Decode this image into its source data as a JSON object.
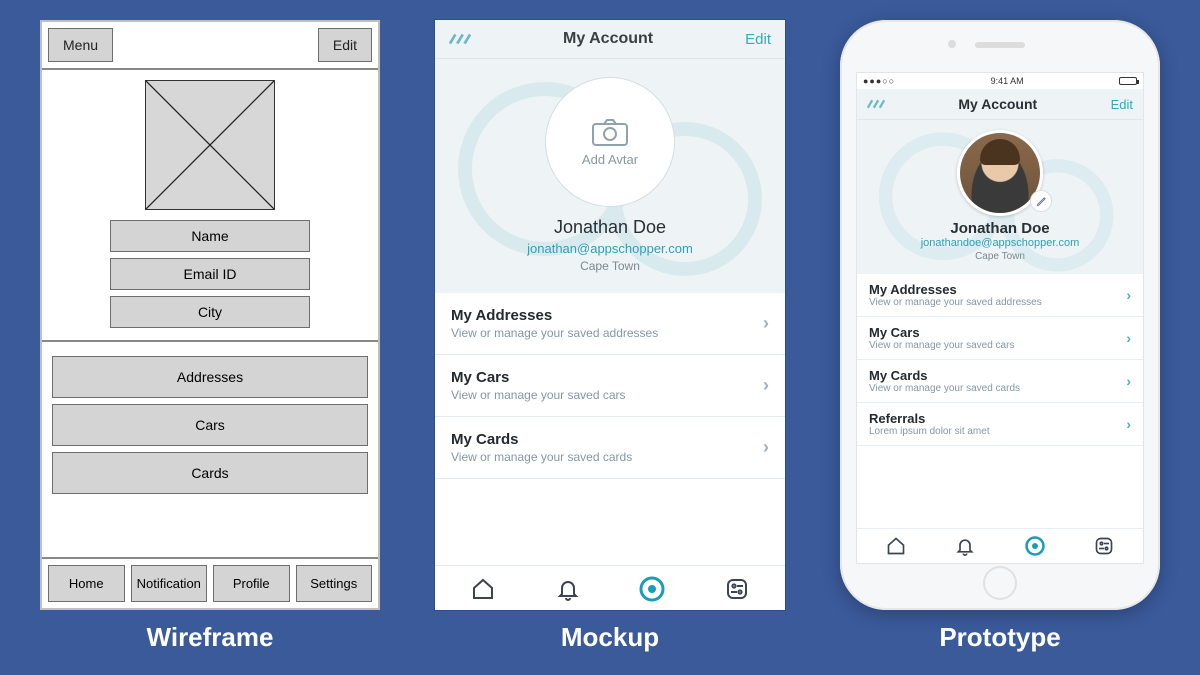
{
  "captions": {
    "wireframe": "Wireframe",
    "mockup": "Mockup",
    "prototype": "Prototype"
  },
  "wireframe": {
    "menu": "Menu",
    "edit": "Edit",
    "fields": {
      "name": "Name",
      "email": "Email ID",
      "city": "City"
    },
    "rows": {
      "addresses": "Addresses",
      "cars": "Cars",
      "cards": "Cards"
    },
    "tabs": {
      "home": "Home",
      "notification": "Notification",
      "profile": "Profile",
      "settings": "Settings"
    }
  },
  "mockup": {
    "header": {
      "title": "My Account",
      "edit": "Edit"
    },
    "avatar_label": "Add Avtar",
    "name": "Jonathan Doe",
    "email": "jonathan@appschopper.com",
    "city": "Cape Town",
    "items": [
      {
        "title": "My Addresses",
        "sub": "View or manage your saved addresses"
      },
      {
        "title": "My Cars",
        "sub": "View or manage your saved cars"
      },
      {
        "title": "My Cards",
        "sub": "View or manage your saved cards"
      }
    ]
  },
  "prototype": {
    "status": {
      "carrier": "●●●○○",
      "time": "9:41 AM"
    },
    "header": {
      "title": "My Account",
      "edit": "Edit"
    },
    "name": "Jonathan Doe",
    "email": "jonathandoe@appschopper.com",
    "city": "Cape Town",
    "items": [
      {
        "title": "My Addresses",
        "sub": "View or manage your saved addresses"
      },
      {
        "title": "My Cars",
        "sub": "View or manage your saved cars"
      },
      {
        "title": "My Cards",
        "sub": "View or manage your saved cards"
      },
      {
        "title": "Referrals",
        "sub": "Lorem ipsum dolor sit amet"
      }
    ]
  }
}
